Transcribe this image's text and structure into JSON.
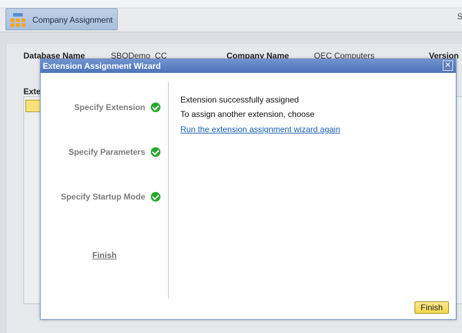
{
  "app": {
    "tab_label": "Company Assignment",
    "top_right": "S"
  },
  "background": {
    "headers": {
      "database_name": "Database Name",
      "company_name": "Company Name",
      "version": "Version"
    },
    "values": {
      "database": "SBODemo_CC",
      "company": "OEC Computers"
    },
    "section_label": "Exte"
  },
  "dialog": {
    "title": "Extension Assignment Wizard",
    "close_glyph": "✕",
    "steps": [
      {
        "label": "Specify Extension",
        "done": true
      },
      {
        "label": "Specify Parameters",
        "done": true
      },
      {
        "label": "Specify Startup Mode",
        "done": true
      }
    ],
    "finish_step_label": "Finish",
    "message_1": "Extension successfully assigned",
    "message_2": "To assign another extension, choose",
    "link_text": "Run the extension assignment wizard again",
    "finish_button": "Finish"
  },
  "colors": {
    "title_bar": "#5a80c2",
    "check": "#26a82d",
    "link": "#1a5fb4",
    "finish_button": "#f7dc5e"
  }
}
